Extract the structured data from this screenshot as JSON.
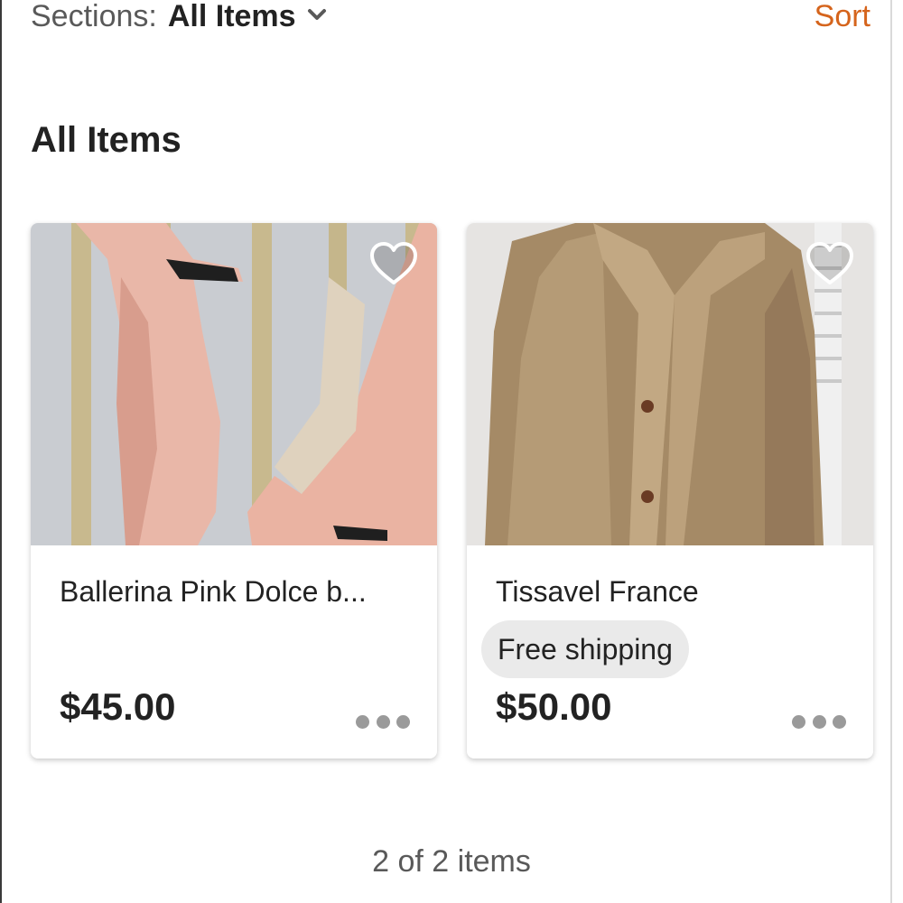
{
  "header": {
    "sections_label": "Sections:",
    "sections_value": "All Items",
    "sort_label": "Sort"
  },
  "section_title": "All Items",
  "items": [
    {
      "title": "Ballerina Pink Dolce b...",
      "badge": "",
      "price": "$45.00",
      "image": "pink-pumps-photo"
    },
    {
      "title": "Tissavel France",
      "badge": "Free shipping",
      "price": "$50.00",
      "image": "fur-coat-photo"
    }
  ],
  "footer": {
    "count_text": "2 of 2 items"
  },
  "colors": {
    "accent": "#d5641c",
    "text": "#222222",
    "muted": "#595959",
    "badge_bg": "#eaeaea"
  },
  "icons": [
    "chevron-down-icon",
    "heart-icon",
    "more-options-icon"
  ]
}
